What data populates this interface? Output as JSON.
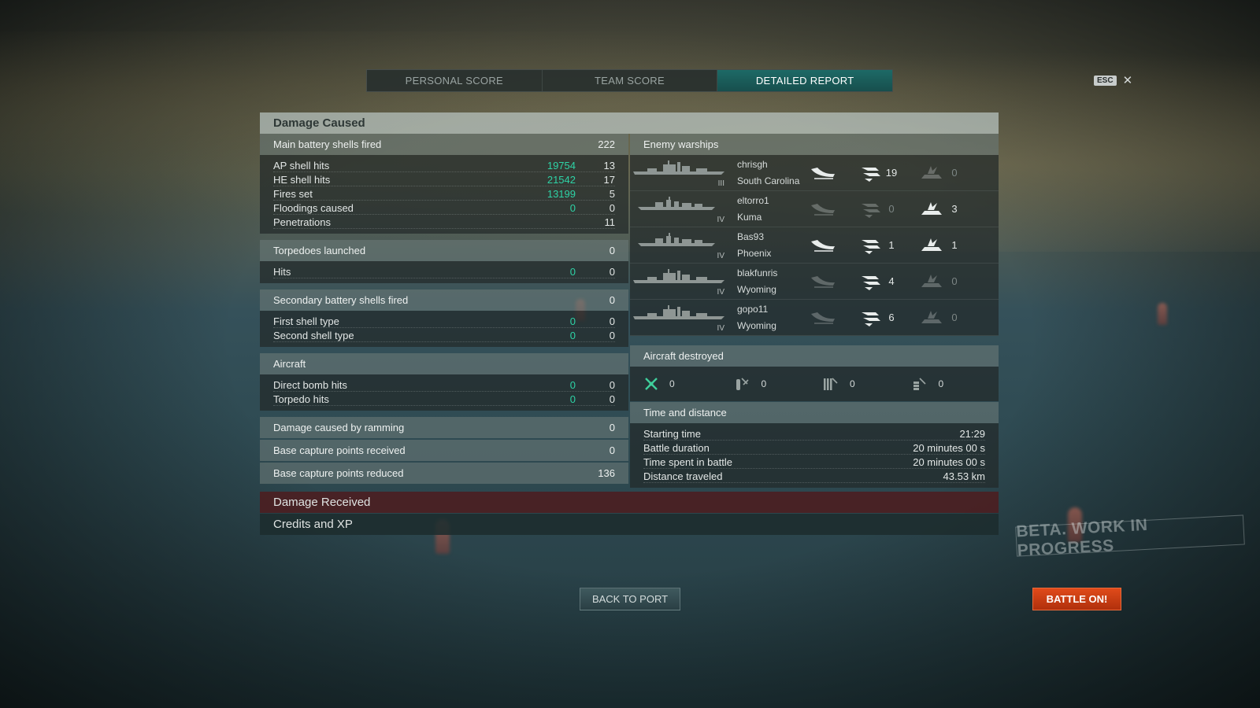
{
  "tabs": [
    {
      "label": "PERSONAL SCORE",
      "active": false
    },
    {
      "label": "TEAM SCORE",
      "active": false
    },
    {
      "label": "DETAILED REPORT",
      "active": true
    }
  ],
  "esc": {
    "key": "ESC",
    "close_icon": "close-icon"
  },
  "damage_caused": {
    "title": "Damage Caused",
    "main_battery": {
      "label": "Main battery shells fired",
      "value": "222",
      "rows": [
        {
          "label": "AP shell hits",
          "damage": "19754",
          "value": "13"
        },
        {
          "label": "HE shell hits",
          "damage": "21542",
          "value": "17"
        },
        {
          "label": "Fires set",
          "damage": "13199",
          "value": "5"
        },
        {
          "label": "Floodings caused",
          "damage": "0",
          "value": "0"
        },
        {
          "label": "Penetrations",
          "damage": "",
          "value": "11"
        }
      ]
    },
    "torpedoes": {
      "label": "Torpedoes launched",
      "value": "0",
      "rows": [
        {
          "label": "Hits",
          "damage": "0",
          "value": "0"
        }
      ]
    },
    "secondary": {
      "label": "Secondary battery shells fired",
      "value": "0",
      "rows": [
        {
          "label": "First shell type",
          "damage": "0",
          "value": "0"
        },
        {
          "label": "Second shell type",
          "damage": "0",
          "value": "0"
        }
      ]
    },
    "aircraft": {
      "label": "Aircraft",
      "rows": [
        {
          "label": "Direct bomb hits",
          "damage": "0",
          "value": "0"
        },
        {
          "label": "Torpedo hits",
          "damage": "0",
          "value": "0"
        }
      ]
    },
    "ramming": {
      "label": "Damage caused by ramming",
      "value": "0"
    },
    "base_received": {
      "label": "Base capture points received",
      "value": "0"
    },
    "base_reduced": {
      "label": "Base capture points reduced",
      "value": "136"
    }
  },
  "enemy_warships": {
    "label": "Enemy warships",
    "ships": [
      {
        "player": "chrisgh",
        "ship": "South Carolina",
        "tier": "III",
        "class": "battleship",
        "destroyed": true,
        "spotted": "19",
        "damaged": "0",
        "spotted_active": true,
        "damaged_active": false
      },
      {
        "player": "eltorro1",
        "ship": "Kuma",
        "tier": "IV",
        "class": "cruiser",
        "destroyed": false,
        "spotted": "0",
        "damaged": "3",
        "spotted_active": false,
        "damaged_active": true
      },
      {
        "player": "Bas93",
        "ship": "Phoenix",
        "tier": "IV",
        "class": "cruiser",
        "destroyed": true,
        "spotted": "1",
        "damaged": "1",
        "spotted_active": true,
        "damaged_active": true
      },
      {
        "player": "blakfunris",
        "ship": "Wyoming",
        "tier": "IV",
        "class": "battleship",
        "destroyed": false,
        "spotted": "4",
        "damaged": "0",
        "spotted_active": true,
        "damaged_active": false
      },
      {
        "player": "gopo11",
        "ship": "Wyoming",
        "tier": "IV",
        "class": "battleship",
        "destroyed": false,
        "spotted": "6",
        "damaged": "0",
        "spotted_active": true,
        "damaged_active": false
      }
    ]
  },
  "aircraft_destroyed": {
    "label": "Aircraft destroyed",
    "items": [
      {
        "icon": "fighter-icon",
        "value": "0"
      },
      {
        "icon": "bomber-icon",
        "value": "0"
      },
      {
        "icon": "torpedo-bomber-icon",
        "value": "0"
      },
      {
        "icon": "dive-bomber-icon",
        "value": "0"
      }
    ]
  },
  "time_distance": {
    "label": "Time and distance",
    "rows": [
      {
        "label": "Starting time",
        "value": "21:29"
      },
      {
        "label": "Battle duration",
        "value": "20 minutes 00 s"
      },
      {
        "label": "Time spent in battle",
        "value": "20 minutes 00 s"
      },
      {
        "label": "Distance traveled",
        "value": "43.53 km"
      }
    ]
  },
  "damage_received": {
    "label": "Damage Received"
  },
  "credits_xp": {
    "label": "Credits and XP"
  },
  "beta_stamp": "BETA. WORK IN PROGRESS",
  "buttons": {
    "back_to_port": "BACK TO PORT",
    "battle_on": "BATTLE ON!"
  },
  "colors": {
    "accent_green": "#2ed3a6",
    "tab_active": "#1d6a66",
    "battle_button": "#d03c14",
    "damage_received_bg": "#4e1c1e"
  }
}
